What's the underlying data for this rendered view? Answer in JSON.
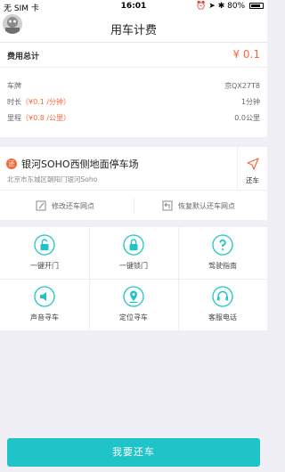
{
  "status_bar": {
    "carrier": "无 SIM 卡",
    "time": "16:01",
    "battery": "80%"
  },
  "nav": {
    "title": "用车计费"
  },
  "fee": {
    "total_label": "费用总计",
    "total_amount": "¥ 0.1",
    "rows": [
      {
        "label": "车牌",
        "rate": "",
        "value": "京QX27T8"
      },
      {
        "label": "时长",
        "rate": "（¥0.1 /分钟）",
        "value": "1分钟"
      },
      {
        "label": "里程",
        "rate": "（¥0.8 /公里）",
        "value": "0.0公里"
      }
    ]
  },
  "location": {
    "badge": "还",
    "name": "银河SOHO西侧地面停车场",
    "address": "北京市东城区朝阳门银河Soho",
    "return_label": "还车",
    "actions": [
      "修改还车网点",
      "恢复默认还车网点"
    ]
  },
  "functions": [
    {
      "label": "一键开门",
      "icon": "unlock-icon"
    },
    {
      "label": "一键锁门",
      "icon": "lock-icon"
    },
    {
      "label": "驾驶指南",
      "icon": "question-icon"
    },
    {
      "label": "声音寻车",
      "icon": "speaker-icon"
    },
    {
      "label": "定位寻车",
      "icon": "location-icon"
    },
    {
      "label": "客服电话",
      "icon": "headset-icon"
    }
  ],
  "main_button": {
    "label": "我要还车"
  },
  "colors": {
    "accent": "#1fc4c9",
    "price": "#f26a3d"
  }
}
